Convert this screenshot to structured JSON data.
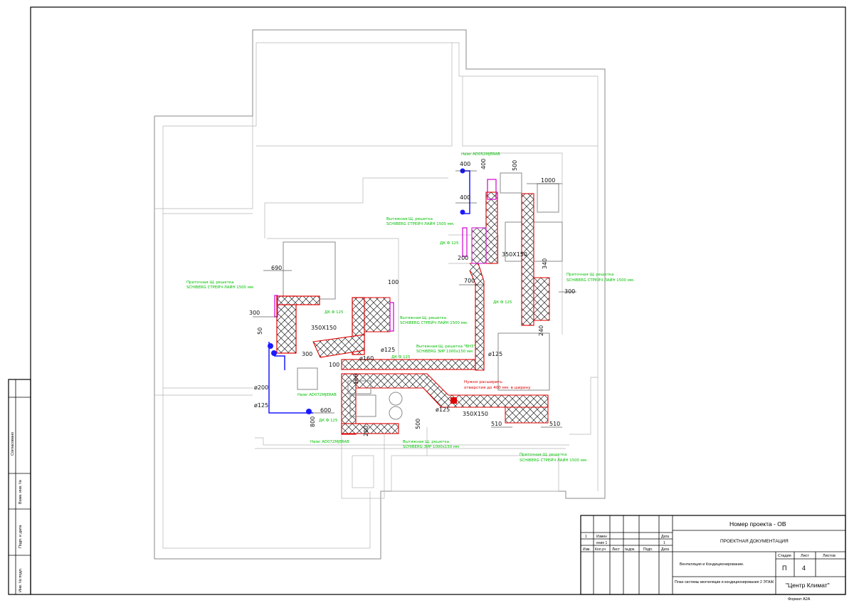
{
  "title_block": {
    "project_number": "Номер проекта - ОВ",
    "doc_type": "ПРОЕКТНАЯ ДОКУМЕНТАЦИЯ",
    "revision_row": {
      "num": "1",
      "change": "Измен",
      "change2": "ение 1",
      "date_label": "Дата",
      "date_val": "1"
    },
    "headers": [
      "Изм.",
      "Кол.уч",
      "Лист",
      "№док.",
      "Подп.",
      "Дата"
    ],
    "section": "Вентиляция и Кондиционирование.",
    "sheet_title": "План системы вентиляции и кондиционирования 2 ЭТАЖ",
    "stage_label": "Стадия",
    "sheet_label": "Лист",
    "sheets_label": "Листов",
    "stage": "П",
    "sheet": "4",
    "sheets": "",
    "company": "\"Центр Климат\"",
    "format": "Формат А2А"
  },
  "side_stamp": [
    "Согласовано",
    "Взам. инв. №",
    "Подп. и дата",
    "Инв. № подл."
  ],
  "annotations": {
    "unit_top": "Haier AD052MJERAB",
    "unit_mid": "Haier AD072MJERAB",
    "unit_bottom": "Haier AD072MJERAB",
    "exhaust1_a": "Вытяжная Щ. решетка",
    "exhaust1_b": "SCHIBERG СТРЕЙЧ ЛАЙН 1500 мм.",
    "supply_left_a": "Приточная Щ. решетка",
    "supply_left_b": "SCHIBERG СТРЕЙЧ ЛАЙН 1500 мм.",
    "exhaust_mid_a": "Вытяжная Щ. решетка",
    "exhaust_mid_b": "SCHIBERG СТРЕЙЧ ЛАЙН 1500 мм.",
    "exhaust_vnz_a": "Вытяжная Щ. решетка \"ВНЗ\"",
    "exhaust_vnz_b": "SCHIBERG ЗИР 1000х150 мм",
    "supply_right_a": "Приточная Щ. решетка",
    "supply_right_b": "SCHIBERG СТРЕЙЧ ЛАЙН 1500 мм.",
    "exhaust_bottom_a": "Вытяжная Щ. решетка",
    "exhaust_bottom_b": "SCHIBERG ЗИР 1000х150 мм",
    "supply_bottom_a": "Приточная Щ. решетка",
    "supply_bottom_b": "SCHIBERG СТРЕЙЧ ЛАЙН 1500 мм.",
    "dk1": "ДК Ф 125",
    "dk2": "ДК Ф 125",
    "dk3": "ДК Ф 125",
    "dk4": "ДК Ф 125",
    "dk5": "ДК Ф 125",
    "note_a": "Нужно расширить",
    "note_b": "отверстия до 400 мм. в ширину"
  },
  "dimensions": [
    "400",
    "400",
    "400",
    "500",
    "1000",
    "200",
    "350Х150",
    "700",
    "340",
    "300",
    "690",
    "300",
    "100",
    "50",
    "350Х150",
    "300",
    "100",
    "100",
    "600",
    "800",
    "200",
    "125",
    "500",
    "350Х150",
    "510",
    "510",
    "240",
    "ø160",
    "ø125",
    "ø125",
    "ø200",
    "ø125",
    "ø125"
  ],
  "colors": {
    "duct_outline": "#e00000",
    "label_green": "#00c000",
    "pipe_blue": "#1a1aff",
    "grille_magenta": "#d000d0",
    "wall_gray": "#8a8a8a"
  }
}
